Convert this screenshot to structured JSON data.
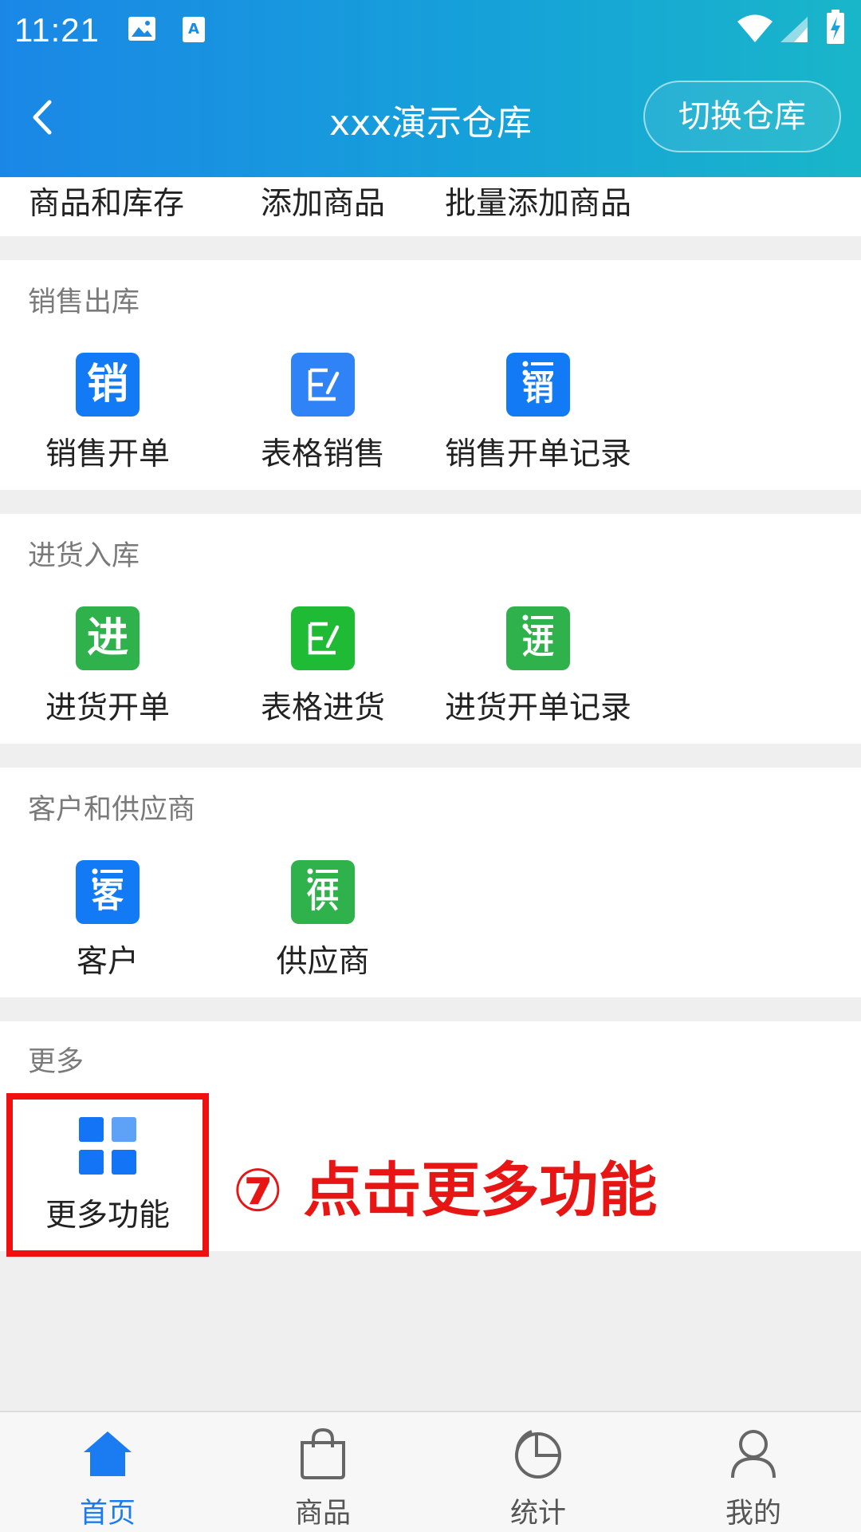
{
  "status_bar": {
    "time": "11:21"
  },
  "header": {
    "title": "xxx演示仓库",
    "switch_label": "切换仓库"
  },
  "top_row": {
    "items": [
      "商品和库存",
      "添加商品",
      "批量添加商品"
    ]
  },
  "sections": [
    {
      "title": "销售出库",
      "items": [
        {
          "label": "销售开单",
          "glyph": "销"
        },
        {
          "label": "表格销售",
          "glyph": ""
        },
        {
          "label": "销售开单记录",
          "glyph": "销"
        }
      ]
    },
    {
      "title": "进货入库",
      "items": [
        {
          "label": "进货开单",
          "glyph": "进"
        },
        {
          "label": "表格进货",
          "glyph": ""
        },
        {
          "label": "进货开单记录",
          "glyph": "进"
        }
      ]
    },
    {
      "title": "客户和供应商",
      "items": [
        {
          "label": "客户",
          "glyph": "客"
        },
        {
          "label": "供应商",
          "glyph": "供"
        }
      ]
    },
    {
      "title": "更多",
      "items": [
        {
          "label": "更多功能"
        }
      ]
    }
  ],
  "annotation": "⑦ 点击更多功能",
  "tabbar": {
    "items": [
      "首页",
      "商品",
      "统计",
      "我的"
    ],
    "active": "首页"
  },
  "colors": {
    "accent": "#1a7cf0",
    "highlight": "#f01010",
    "sale_icon": "#137af5",
    "purchase_icon": "#2fb24c"
  }
}
